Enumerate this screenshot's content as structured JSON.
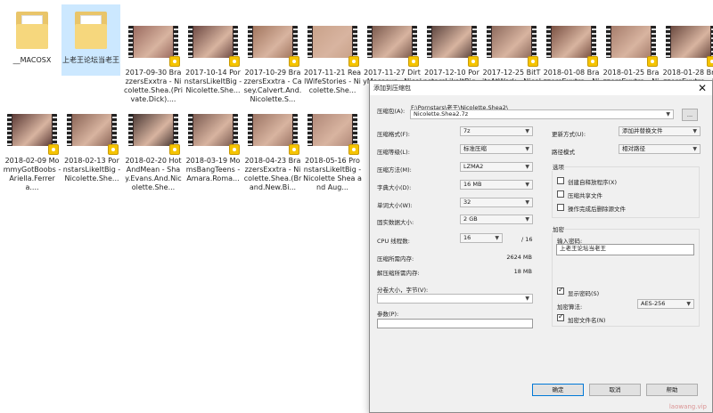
{
  "explorer": {
    "items": [
      {
        "type": "folder",
        "name": "__MACOSX",
        "selected": false
      },
      {
        "type": "folder",
        "name": "上老王论坛当老王",
        "selected": true
      },
      {
        "type": "video",
        "name": "2017-09-30 BrazzersExxtra - Nicolette.Shea.(Private.Dick)....",
        "color": "#9b6b60"
      },
      {
        "type": "video",
        "name": "2017-10-14 PornstarsLikeItBig - Nicolette.She...",
        "color": "#6e4a44"
      },
      {
        "type": "video",
        "name": "2017-10-29 BrazzersExxtra - Casey.Calvert.And.Nicolette.S...",
        "color": "#a2765f"
      },
      {
        "type": "video",
        "name": "2017-11-21 RealWifeStories - Nicolette.She...",
        "color": "#c9a28a"
      },
      {
        "type": "video",
        "name": "2017-11-27 DirtyMasseur - Nicolette.She...",
        "color": "#7b5a4e"
      },
      {
        "type": "video",
        "name": "2017-12-10 PornstarsLikeItBig - Nicolette Shea",
        "color": "#5e4640"
      },
      {
        "type": "video",
        "name": "2017-12-25 BitTitsAtWork - Nicolette Shea",
        "color": "#8d6a5d"
      },
      {
        "type": "video",
        "name": "2018-01-08 BrazzersExxtra - Nicolette.Shea.(...",
        "color": "#7a5143"
      },
      {
        "type": "video",
        "name": "2018-01-25 BrazzersExxtra - Nicolette.Shea.(...",
        "color": "#a67d6c"
      },
      {
        "type": "video",
        "name": "2018-01-28 BrazzersExxtra - Madison.Ivy.M...",
        "color": "#6b4a40"
      },
      {
        "type": "video",
        "name": "2018-02-09 MommyGotBoobs - Ariella.Ferrera....",
        "color": "#5b3a36"
      },
      {
        "type": "video",
        "name": "2018-02-13 PornstarsLikeItBig - Nicolette.She...",
        "color": "#8a6456"
      },
      {
        "type": "video",
        "name": "2018-02-20 HotAndMean - Shay.Evans.And.Nicolette.She...",
        "color": "#4c3a36"
      },
      {
        "type": "video",
        "name": "2018-03-19 MomsBangTeens - Amara.Roma...",
        "color": "#7c5c52"
      },
      {
        "type": "video",
        "name": "2018-04-23 BrazzersExxtra - Nicolette.Shea.(Brand.New.Bi...",
        "color": "#9c7565"
      },
      {
        "type": "video",
        "name": "2018-05-16 PronstarsLikeItBig - Nicolette Shea and Aug...",
        "color": "#b08878"
      }
    ]
  },
  "dialog": {
    "title": "添加到压缩包",
    "archive_label": "压缩包(A):",
    "archive_path": "F:\\Pornstars\\老王\\Nicolette.Shea2\\",
    "archive_name": "Nicolette.Shea2.7z",
    "browse_label": "...",
    "format_label": "压缩格式(F):",
    "format_value": "7z",
    "level_label": "压缩等级(L):",
    "level_value": "标准压缩",
    "method_label": "压缩方法(M):",
    "method_value": "LZMA2",
    "dict_label": "字典大小(D):",
    "dict_value": "16 MB",
    "word_label": "单词大小(W):",
    "word_value": "32",
    "solid_label": "固实数据大小:",
    "solid_value": "2 GB",
    "threads_label": "CPU 线程数:",
    "threads_value": "16",
    "threads_total": "/ 16",
    "mem_compress_label": "压缩所需内存:",
    "mem_compress_value": "2624 MB",
    "mem_decompress_label": "解压缩所需内存:",
    "mem_decompress_value": "18 MB",
    "split_label": "分卷大小，字节(V):",
    "split_value": "",
    "params_label": "参数(P):",
    "params_value": "",
    "update_label": "更新方式(U):",
    "update_value": "添加并替换文件",
    "path_mode_label": "路径模式",
    "path_mode_value": "相对路径",
    "options_title": "选项",
    "opt_sfx": "创建自释放程序(X)",
    "opt_shared": "压缩共享文件",
    "opt_delete": "操作完成后删除源文件",
    "encrypt_title": "加密",
    "password_label": "输入密码:",
    "password_value": "上老王论坛当老王",
    "show_password": "显示密码(S)",
    "enc_method_label": "加密算法:",
    "enc_method_value": "AES-256",
    "encrypt_names": "加密文件名(N)",
    "ok": "确定",
    "cancel": "取消",
    "help": "帮助"
  },
  "watermark": "laowang.vip"
}
